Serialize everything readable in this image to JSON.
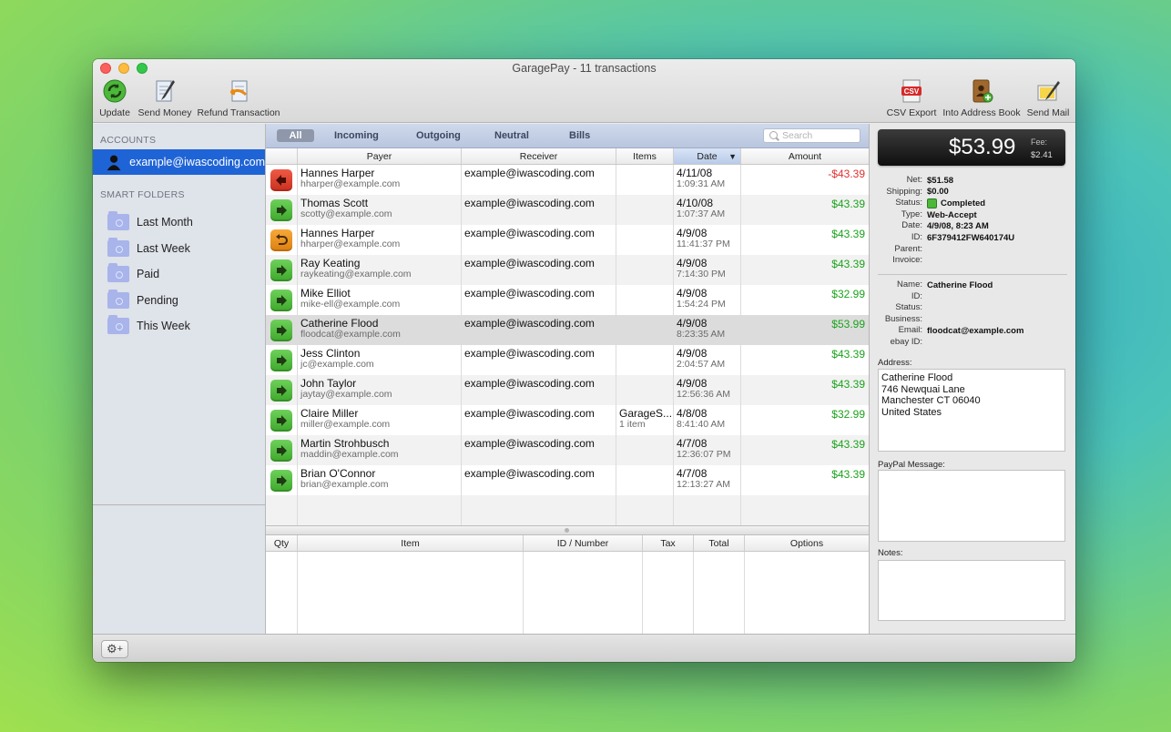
{
  "window": {
    "title": "GaragePay - 11 transactions"
  },
  "toolbar": {
    "update": "Update",
    "send_money": "Send Money",
    "refund": "Refund Transaction",
    "csv_export": "CSV Export",
    "address_book": "Into Address Book",
    "send_mail": "Send Mail",
    "csv_badge": "CSV"
  },
  "sidebar": {
    "accounts_header": "ACCOUNTS",
    "account": "example@iwascoding.com",
    "smart_header": "SMART FOLDERS",
    "folders": [
      "Last Month",
      "Last Week",
      "Paid",
      "Pending",
      "This Week"
    ]
  },
  "filters": {
    "tabs": [
      "All",
      "Incoming",
      "Outgoing",
      "Neutral",
      "Bills"
    ],
    "active": "All",
    "search_placeholder": "Search"
  },
  "table": {
    "columns": [
      "Payer",
      "Receiver",
      "Items",
      "Date",
      "Amount"
    ],
    "sorted_column": "Date",
    "rows": [
      {
        "status": "outgoing",
        "payer": "Hannes Harper",
        "payer_email": "hharper@example.com",
        "receiver": "example@iwascoding.com",
        "items": "",
        "items_sub": "",
        "date": "4/11/08",
        "time": "1:09:31 AM",
        "amount": "-$43.39"
      },
      {
        "status": "incoming",
        "payer": "Thomas Scott",
        "payer_email": "scotty@example.com",
        "receiver": "example@iwascoding.com",
        "items": "",
        "items_sub": "",
        "date": "4/10/08",
        "time": "1:07:37 AM",
        "amount": "$43.39"
      },
      {
        "status": "refund",
        "payer": "Hannes Harper",
        "payer_email": "hharper@example.com",
        "receiver": "example@iwascoding.com",
        "items": "",
        "items_sub": "",
        "date": "4/9/08",
        "time": "11:41:37 PM",
        "amount": "$43.39"
      },
      {
        "status": "incoming",
        "payer": "Ray Keating",
        "payer_email": "raykeating@example.com",
        "receiver": "example@iwascoding.com",
        "items": "",
        "items_sub": "",
        "date": "4/9/08",
        "time": "7:14:30 PM",
        "amount": "$43.39"
      },
      {
        "status": "incoming",
        "payer": "Mike Elliot",
        "payer_email": "mike-ell@example.com",
        "receiver": "example@iwascoding.com",
        "items": "",
        "items_sub": "",
        "date": "4/9/08",
        "time": "1:54:24 PM",
        "amount": "$32.99"
      },
      {
        "status": "incoming",
        "payer": "Catherine Flood",
        "payer_email": "floodcat@example.com",
        "receiver": "example@iwascoding.com",
        "items": "",
        "items_sub": "",
        "date": "4/9/08",
        "time": "8:23:35 AM",
        "amount": "$53.99"
      },
      {
        "status": "incoming",
        "payer": "Jess Clinton",
        "payer_email": "jc@example.com",
        "receiver": "example@iwascoding.com",
        "items": "",
        "items_sub": "",
        "date": "4/9/08",
        "time": "2:04:57 AM",
        "amount": "$43.39"
      },
      {
        "status": "incoming",
        "payer": "John Taylor",
        "payer_email": "jaytay@example.com",
        "receiver": "example@iwascoding.com",
        "items": "",
        "items_sub": "",
        "date": "4/9/08",
        "time": "12:56:36 AM",
        "amount": "$43.39"
      },
      {
        "status": "incoming",
        "payer": "Claire Miller",
        "payer_email": "miller@example.com",
        "receiver": "example@iwascoding.com",
        "items": "GarageS...",
        "items_sub": "1 item",
        "date": "4/8/08",
        "time": "8:41:40 AM",
        "amount": "$32.99"
      },
      {
        "status": "incoming",
        "payer": "Martin Strohbusch",
        "payer_email": "maddin@example.com",
        "receiver": "example@iwascoding.com",
        "items": "",
        "items_sub": "",
        "date": "4/7/08",
        "time": "12:36:07 PM",
        "amount": "$43.39"
      },
      {
        "status": "incoming",
        "payer": "Brian O'Connor",
        "payer_email": "brian@example.com",
        "receiver": "example@iwascoding.com",
        "items": "",
        "items_sub": "",
        "date": "4/7/08",
        "time": "12:13:27 AM",
        "amount": "$43.39"
      }
    ],
    "selected_index": 5
  },
  "items_table": {
    "columns": [
      "Qty",
      "Item",
      "ID / Number",
      "Tax",
      "Total",
      "Options"
    ]
  },
  "details": {
    "total": "$53.99",
    "fee_label": "Fee:",
    "fee": "$2.41",
    "fields": [
      {
        "k": "Net:",
        "v": "$51.58"
      },
      {
        "k": "Shipping:",
        "v": "$0.00"
      },
      {
        "k": "Status:",
        "v": "Completed"
      },
      {
        "k": "Type:",
        "v": "Web-Accept"
      },
      {
        "k": "Date:",
        "v": "4/9/08, 8:23 AM"
      },
      {
        "k": "ID:",
        "v": "6F379412FW640174U"
      },
      {
        "k": "Parent:",
        "v": ""
      },
      {
        "k": "Invoice:",
        "v": ""
      }
    ],
    "buyer": [
      {
        "k": "Name:",
        "v": "Catherine Flood"
      },
      {
        "k": "ID:",
        "v": ""
      },
      {
        "k": "Status:",
        "v": ""
      },
      {
        "k": "Business:",
        "v": ""
      },
      {
        "k": "Email:",
        "v": "floodcat@example.com"
      },
      {
        "k": "ebay ID:",
        "v": ""
      }
    ],
    "address_label": "Address:",
    "address_lines": [
      "Catherine Flood",
      "746 Newquai Lane",
      "Manchester CT 06040",
      "United States"
    ],
    "paypal_message_label": "PayPal Message:",
    "paypal_message": "",
    "notes_label": "Notes:",
    "notes": ""
  },
  "colors": {
    "selection": "#1f64d6",
    "positive": "#1aa31a",
    "negative": "#e03030"
  }
}
